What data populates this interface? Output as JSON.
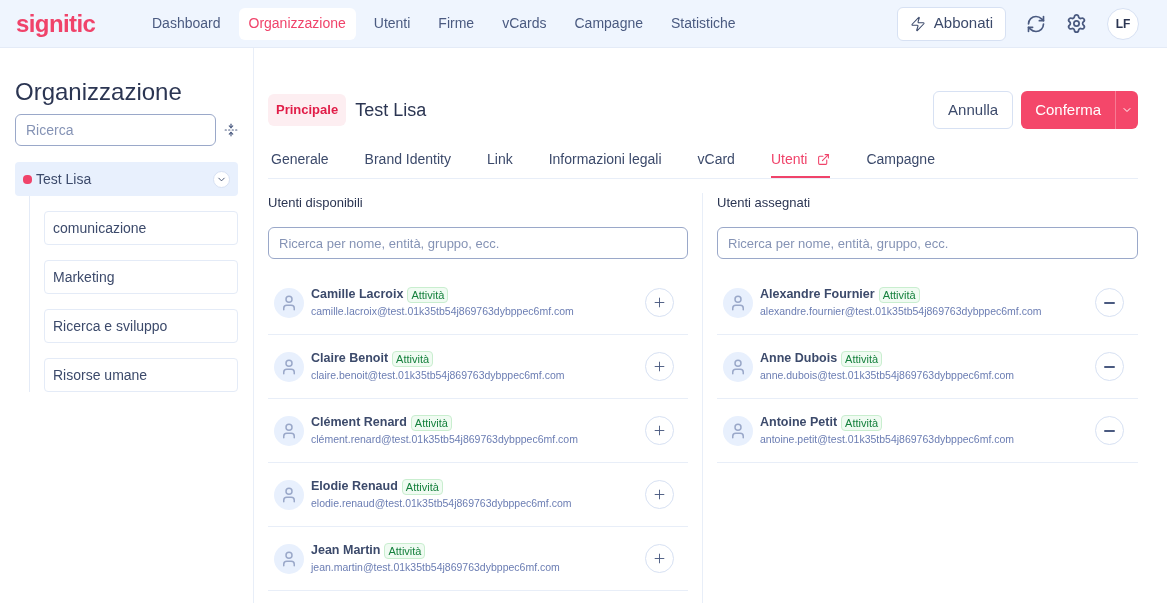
{
  "logo": "signitic",
  "nav": [
    {
      "label": "Dashboard",
      "selected": false
    },
    {
      "label": "Organizzazione",
      "selected": true
    },
    {
      "label": "Utenti",
      "selected": false
    },
    {
      "label": "Firme",
      "selected": false
    },
    {
      "label": "vCards",
      "selected": false
    },
    {
      "label": "Campagne",
      "selected": false
    },
    {
      "label": "Statistiche",
      "selected": false
    }
  ],
  "subscribe_button": "Abbonati",
  "avatar_initials": "LF",
  "sidebar": {
    "title": "Organizzazione",
    "search": {
      "placeholder": "Ricerca"
    },
    "tree": [
      {
        "label": "Test Lisa",
        "selected": true,
        "expanded": true,
        "color": "#f0436a",
        "children": [
          {
            "label": "comunicazione",
            "selected": false
          },
          {
            "label": "Marketing",
            "selected": false
          },
          {
            "label": "Ricerca e sviluppo",
            "selected": false
          },
          {
            "label": "Risorse umane",
            "selected": false
          }
        ]
      }
    ]
  },
  "header": {
    "badge": "Principale",
    "title": "Test Lisa",
    "cancel_button": "Annulla",
    "confirm_button": "Conferma"
  },
  "tabs": [
    {
      "label": "Generale",
      "selected": false,
      "external": false
    },
    {
      "label": "Brand Identity",
      "selected": false,
      "external": false
    },
    {
      "label": "Link",
      "selected": false,
      "external": false
    },
    {
      "label": "Informazioni legali",
      "selected": false,
      "external": false
    },
    {
      "label": "vCard",
      "selected": false,
      "external": false
    },
    {
      "label": "Utenti",
      "selected": true,
      "external": true
    },
    {
      "label": "Campagne",
      "selected": false,
      "external": false
    }
  ],
  "panels": [
    {
      "title": "Utenti disponibili",
      "kind": "add",
      "search": {
        "placeholder": "Ricerca per nome, entità, gruppo, ecc."
      },
      "users": [
        {
          "name": "Camille Lacroix",
          "status": "Attività",
          "email": "camille.lacroix@test.01k35tb54j869763dybppec6mf.com"
        },
        {
          "name": "Claire Benoit",
          "status": "Attività",
          "email": "claire.benoit@test.01k35tb54j869763dybppec6mf.com"
        },
        {
          "name": "Clément Renard",
          "status": "Attività",
          "email": "clément.renard@test.01k35tb54j869763dybppec6mf.com"
        },
        {
          "name": "Elodie Renaud",
          "status": "Attività",
          "email": "elodie.renaud@test.01k35tb54j869763dybppec6mf.com"
        },
        {
          "name": "Jean Martin",
          "status": "Attività",
          "email": "jean.martin@test.01k35tb54j869763dybppec6mf.com"
        }
      ]
    },
    {
      "title": "Utenti assegnati",
      "kind": "remove",
      "search": {
        "placeholder": "Ricerca per nome, entità, gruppo, ecc."
      },
      "users": [
        {
          "name": "Alexandre Fournier",
          "status": "Attività",
          "email": "alexandre.fournier@test.01k35tb54j869763dybppec6mf.com"
        },
        {
          "name": "Anne Dubois",
          "status": "Attività",
          "email": "anne.dubois@test.01k35tb54j869763dybppec6mf.com"
        },
        {
          "name": "Antoine Petit",
          "status": "Attività",
          "email": "antoine.petit@test.01k35tb54j869763dybppec6mf.com"
        }
      ]
    }
  ]
}
